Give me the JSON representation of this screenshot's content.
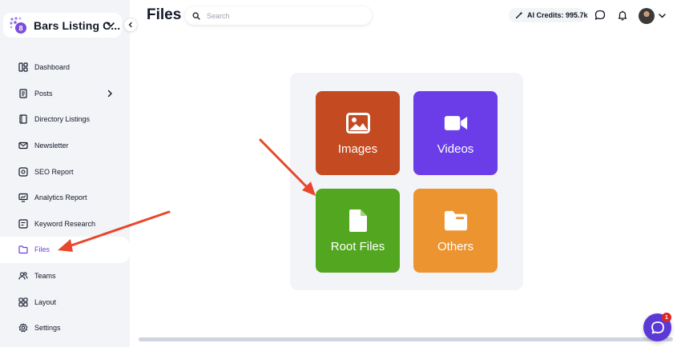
{
  "brand": {
    "name": "Bars Listing C...",
    "logo_icon": "octopus-logo-icon"
  },
  "sidebar": {
    "items": [
      {
        "label": "Dashboard",
        "icon": "dashboard-icon"
      },
      {
        "label": "Posts",
        "icon": "document-icon",
        "has_submenu": true
      },
      {
        "label": "Directory Listings",
        "icon": "book-icon"
      },
      {
        "label": "Newsletter",
        "icon": "mail-icon"
      },
      {
        "label": "SEO Report",
        "icon": "seo-icon"
      },
      {
        "label": "Analytics Report",
        "icon": "analytics-icon"
      },
      {
        "label": "Keyword Research",
        "icon": "keyword-icon"
      },
      {
        "label": "Files",
        "icon": "folder-icon",
        "active": true
      },
      {
        "label": "Teams",
        "icon": "users-icon"
      },
      {
        "label": "Layout",
        "icon": "layout-icon"
      },
      {
        "label": "Settings",
        "icon": "gear-icon"
      }
    ]
  },
  "header": {
    "title": "Files",
    "search_placeholder": "Search",
    "credits_label": "AI Credits: 995.7k"
  },
  "tiles": [
    {
      "label": "Images",
      "icon": "image-icon",
      "color": "#c44a22"
    },
    {
      "label": "Videos",
      "icon": "video-camera-icon",
      "color": "#6a3de8"
    },
    {
      "label": "Root Files",
      "icon": "file-icon",
      "color": "#53a620"
    },
    {
      "label": "Others",
      "icon": "folder-icon",
      "color": "#ec9430"
    }
  ],
  "chat": {
    "badge_count": "1"
  },
  "colors": {
    "accent": "#6b3fe0",
    "annotation_arrow": "#e8472b",
    "chat": "#5b39d6"
  }
}
